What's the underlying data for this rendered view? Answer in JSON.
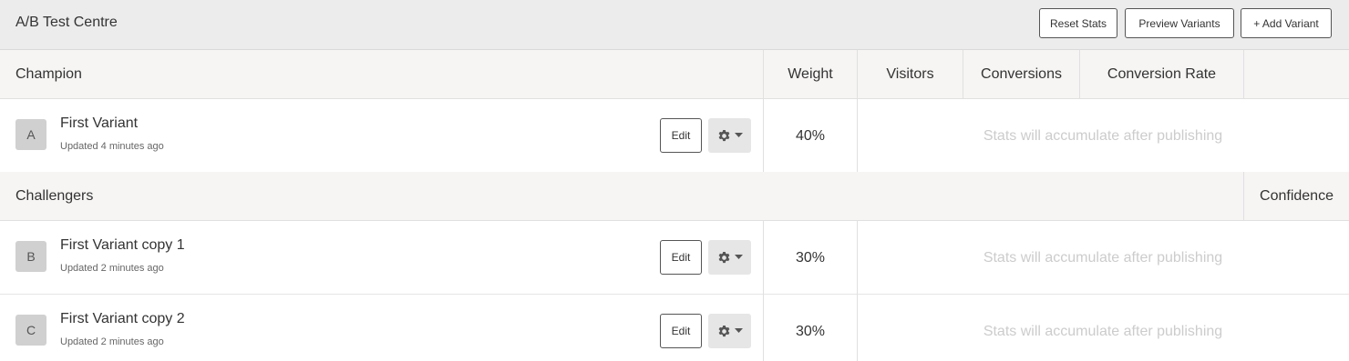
{
  "app": {
    "title": "A/B Test Centre",
    "buttons": {
      "reset": "Reset Stats",
      "preview": "Preview Variants",
      "add": "+ Add Variant"
    }
  },
  "champion_header": {
    "label": "Champion",
    "weight": "Weight",
    "visitors": "Visitors",
    "conversions": "Conversions",
    "conversion_rate": "Conversion Rate"
  },
  "challengers_header": {
    "label": "Challengers",
    "confidence": "Confidence"
  },
  "icons": {
    "settings": "gear-icon",
    "dropdown": "caret-down-icon"
  },
  "variants": [
    {
      "letter": "A",
      "name": "First Variant",
      "updated": "Updated 4 minutes ago",
      "edit": "Edit",
      "weight": "40%",
      "stats": "Stats will accumulate after publishing"
    },
    {
      "letter": "B",
      "name": "First Variant copy 1",
      "updated": "Updated 2 minutes ago",
      "edit": "Edit",
      "weight": "30%",
      "stats": "Stats will accumulate after publishing"
    },
    {
      "letter": "C",
      "name": "First Variant copy 2",
      "updated": "Updated 2 minutes ago",
      "edit": "Edit",
      "weight": "30%",
      "stats": "Stats will accumulate after publishing"
    }
  ]
}
